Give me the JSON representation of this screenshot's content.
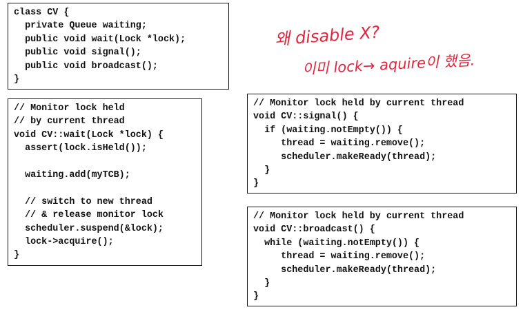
{
  "code_blocks": {
    "class_cv": [
      "class CV {",
      "  private Queue waiting;",
      "  public void wait(Lock *lock);",
      "  public void signal();",
      "  public void broadcast();",
      "}"
    ],
    "wait": [
      "// Monitor lock held",
      "// by current thread",
      "void CV::wait(Lock *lock) {",
      "  assert(lock.isHeld());",
      "",
      "  waiting.add(myTCB);",
      "",
      "  // switch to new thread",
      "  // & release monitor lock",
      "  scheduler.suspend(&lock);",
      "  lock->acquire();",
      "}"
    ],
    "signal": [
      "// Monitor lock held by current thread",
      "void CV::signal() {",
      "  if (waiting.notEmpty()) {",
      "     thread = waiting.remove();",
      "     scheduler.makeReady(thread);",
      "  }",
      "}"
    ],
    "broadcast": [
      "// Monitor lock held by current thread",
      "void CV::broadcast() {",
      "  while (waiting.notEmpty()) {",
      "     thread = waiting.remove();",
      "     scheduler.makeReady(thread);",
      "  }",
      "}"
    ]
  },
  "annotations": {
    "line1": "왜 disable X?",
    "line2": "이미 lock→ aquire이 했음.",
    "ink_color": "#e0263f"
  }
}
